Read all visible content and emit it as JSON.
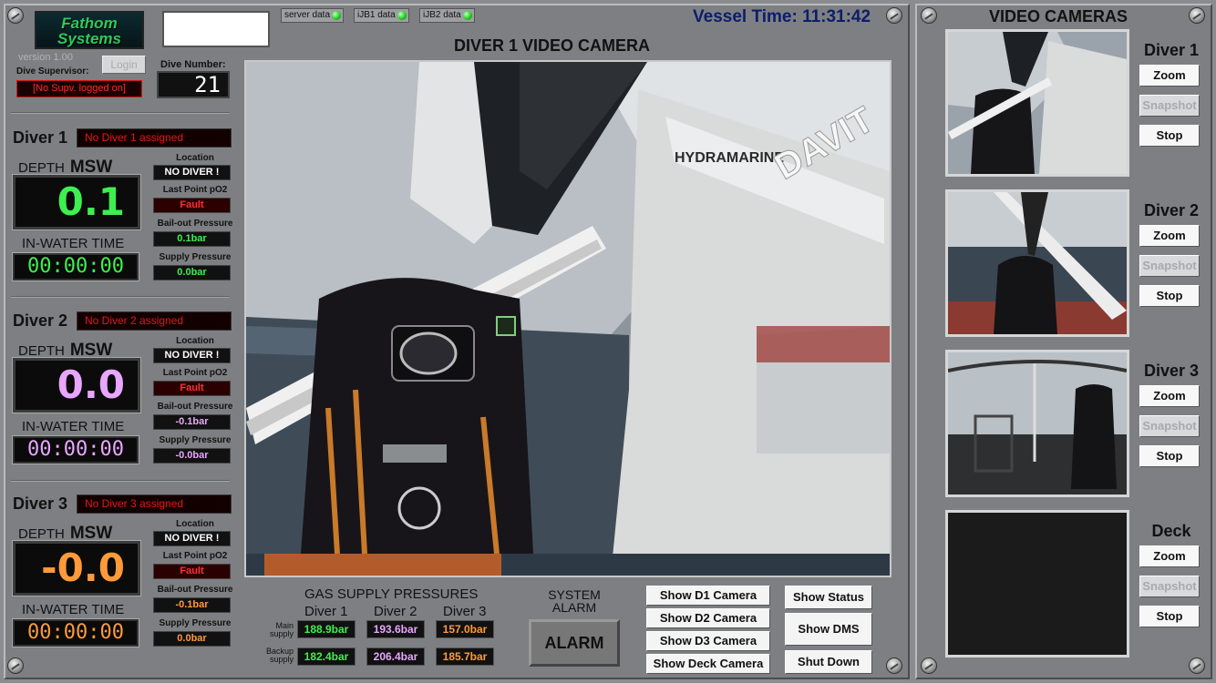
{
  "header": {
    "logo_line1": "Fathom",
    "logo_line2": "Systems",
    "version_label": "version",
    "version_value": "1.00",
    "login_label": "Login",
    "dive_supervisor_label": "Dive Supervisor:",
    "dive_supervisor_status": "[No Supv. logged on]",
    "dive_number_label": "Dive Number:",
    "dive_number": "21",
    "connections": [
      {
        "label": "server data",
        "status_color": "#17c917"
      },
      {
        "label": "iJB1 data",
        "status_color": "#17c917"
      },
      {
        "label": "iJB2 data",
        "status_color": "#17c917"
      }
    ],
    "vessel_time_label": "Vessel Time:",
    "vessel_time": "11:31:42",
    "main_title": "DIVER 1 VIDEO CAMERA"
  },
  "divers": [
    {
      "name": "Diver 1",
      "assigned": "No Diver 1 assigned",
      "depth_label": "DEPTH",
      "depth_unit": "MSW",
      "depth": "0.1",
      "color": "#3df04f",
      "in_water_label": "IN-WATER TIME",
      "in_water_time": "00:00:00",
      "location_label": "Location",
      "location": "NO DIVER !",
      "last_po2_label": "Last Point pO2",
      "last_po2": "Fault",
      "bailout_label": "Bail-out Pressure",
      "bailout": "0.1bar",
      "supply_label": "Supply Pressure",
      "supply": "0.0bar"
    },
    {
      "name": "Diver 2",
      "assigned": "No Diver 2 assigned",
      "depth_label": "DEPTH",
      "depth_unit": "MSW",
      "depth": "0.0",
      "color": "#e8a6ff",
      "in_water_label": "IN-WATER TIME",
      "in_water_time": "00:00:00",
      "location_label": "Location",
      "location": "NO DIVER !",
      "last_po2_label": "Last Point pO2",
      "last_po2": "Fault",
      "bailout_label": "Bail-out Pressure",
      "bailout": "-0.1bar",
      "supply_label": "Supply Pressure",
      "supply": "-0.0bar"
    },
    {
      "name": "Diver 3",
      "assigned": "No Diver 3 assigned",
      "depth_label": "DEPTH",
      "depth_unit": "MSW",
      "depth": "-0.0",
      "color": "#ff9a3a",
      "in_water_label": "IN-WATER TIME",
      "in_water_time": "00:00:00",
      "location_label": "Location",
      "location": "NO DIVER !",
      "last_po2_label": "Last Point pO2",
      "last_po2": "Fault",
      "bailout_label": "Bail-out Pressure",
      "bailout": "-0.1bar",
      "supply_label": "Supply Pressure",
      "supply": "0.0bar"
    }
  ],
  "gas": {
    "title": "GAS SUPPLY PRESSURES",
    "columns": [
      "Diver 1",
      "Diver 2",
      "Diver 3"
    ],
    "main_label_1": "Main",
    "main_label_2": "supply",
    "backup_label_1": "Backup",
    "backup_label_2": "supply",
    "main": [
      "188.9bar",
      "193.6bar",
      "157.0bar"
    ],
    "backup": [
      "182.4bar",
      "206.4bar",
      "185.7bar"
    ]
  },
  "alarm": {
    "title_1": "SYSTEM",
    "title_2": "ALARM",
    "button": "ALARM"
  },
  "controls": {
    "show_d1": "Show D1 Camera",
    "show_d2": "Show D2 Camera",
    "show_d3": "Show D3 Camera",
    "show_deck": "Show Deck Camera",
    "show_status": "Show Status",
    "show_dms": "Show DMS",
    "shut_down": "Shut Down"
  },
  "cameras": {
    "title": "VIDEO CAMERAS",
    "items": [
      {
        "name": "Diver 1",
        "zoom": "Zoom",
        "snapshot": "Snapshot",
        "stop": "Stop"
      },
      {
        "name": "Diver 2",
        "zoom": "Zoom",
        "snapshot": "Snapshot",
        "stop": "Stop"
      },
      {
        "name": "Diver 3",
        "zoom": "Zoom",
        "snapshot": "Snapshot",
        "stop": "Stop"
      },
      {
        "name": "Deck",
        "zoom": "Zoom",
        "snapshot": "Snapshot",
        "stop": "Stop"
      }
    ]
  },
  "video_text": {
    "crane_brand": "HYDRAMARINE",
    "davit_text": "DAVIT"
  }
}
